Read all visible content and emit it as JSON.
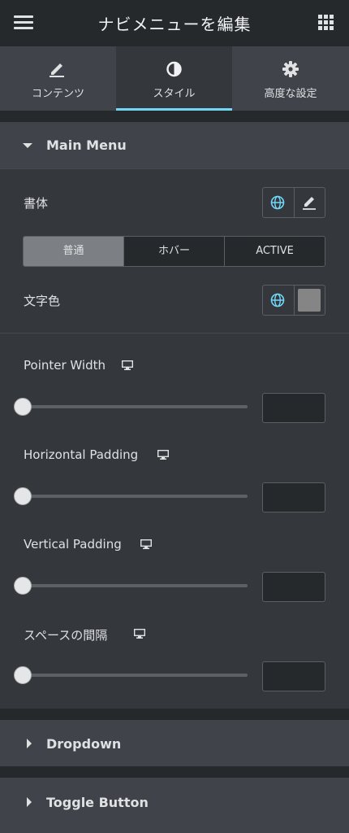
{
  "header": {
    "title": "ナビメニューを編集",
    "menu_icon": "hamburger-icon",
    "apps_icon": "grid-icon"
  },
  "tabs": [
    {
      "label": "コンテンツ",
      "icon": "pencil-icon",
      "active": false
    },
    {
      "label": "スタイル",
      "icon": "half-circle-icon",
      "active": true
    },
    {
      "label": "高度な設定",
      "icon": "gear-icon",
      "active": false
    }
  ],
  "main_menu": {
    "title": "Main Menu",
    "typography_label": "書体",
    "state_tabs": [
      "普通",
      "ホバー",
      "ACTIVE"
    ],
    "text_color_label": "文字色",
    "text_color_swatch": "#858585",
    "controls": [
      {
        "label": "Pointer Width",
        "value": ""
      },
      {
        "label": "Horizontal Padding",
        "value": ""
      },
      {
        "label": "Vertical Padding",
        "value": ""
      },
      {
        "label": "スペースの間隔",
        "value": ""
      }
    ]
  },
  "collapsed_sections": [
    {
      "title": "Dropdown"
    },
    {
      "title": "Toggle Button"
    }
  ],
  "colors": {
    "accent": "#71d7f7",
    "panel": "#34373c",
    "header": "#26292c"
  }
}
